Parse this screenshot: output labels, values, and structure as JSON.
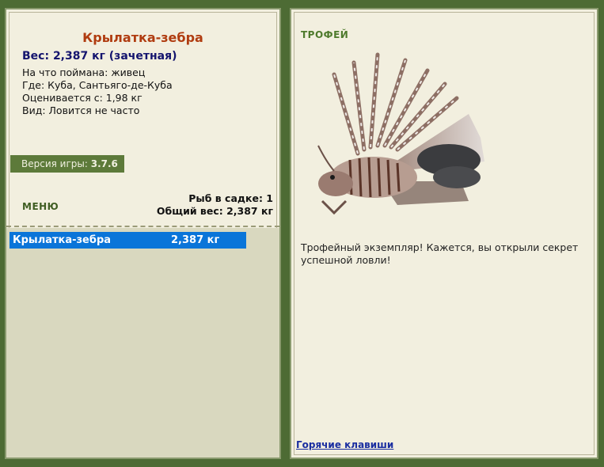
{
  "fish": {
    "title": "Крылатка-зебра",
    "weight_line": "Вес: 2,387 кг (зачетная)",
    "bait": "На что поймана: живец",
    "location": "Где: Куба, Сантьяго-де-Куба",
    "rated_from": "Оценивается с: 1,98 кг",
    "frequency": "Вид: Ловится не часто"
  },
  "version": {
    "label": "Версия игры:",
    "value": "3.7.6"
  },
  "menu": {
    "label": "МЕНЮ"
  },
  "stats": {
    "fish_count": "Рыб в садке: 1",
    "total_weight": "Общий вес: 2,387 кг"
  },
  "catch_list": [
    {
      "name": "Крылатка-зебра",
      "weight": "2,387 кг"
    }
  ],
  "trophy": {
    "title": "ТРОФЕЙ",
    "description": "Трофейный экземпляр! Кажется, вы открыли секрет успешной ловли!"
  },
  "hotkeys": {
    "label": "Горячие клавиши"
  },
  "colors": {
    "background": "#4d6b34",
    "panel": "#f2efdf",
    "fish_title": "#b03c10",
    "weight": "#14146e",
    "selection": "#0a75d9",
    "trophy_title": "#4e7a2c"
  }
}
